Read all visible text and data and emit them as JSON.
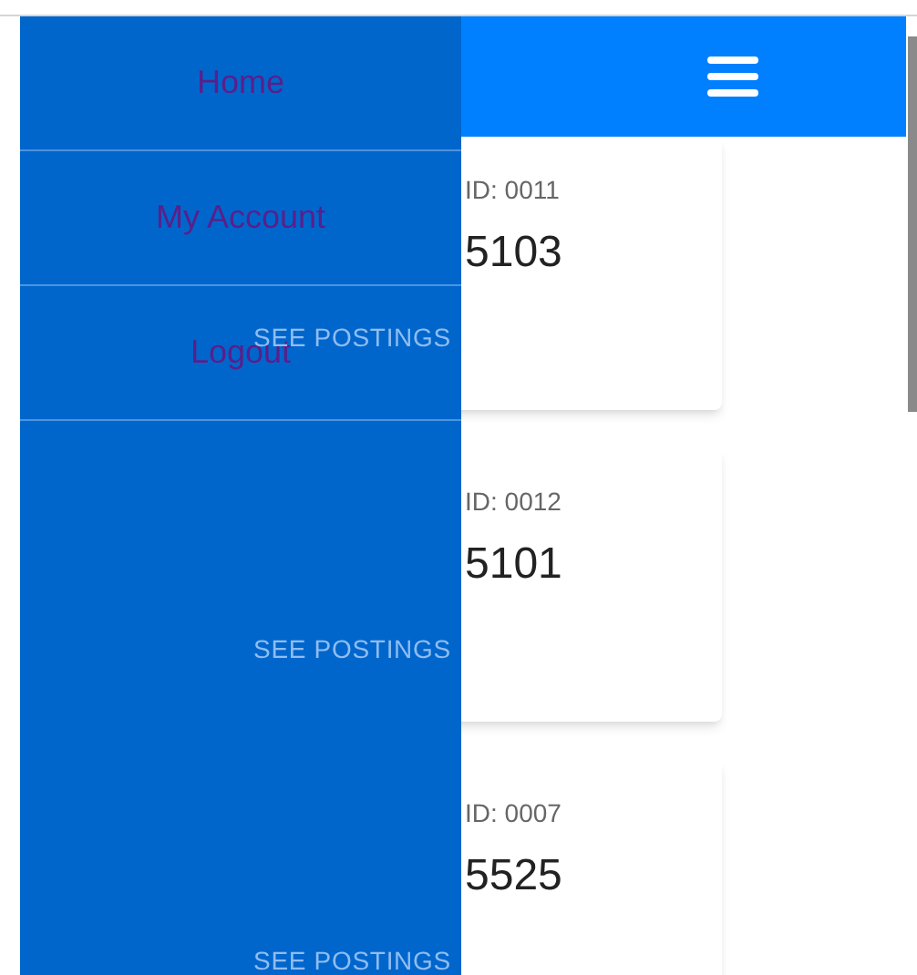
{
  "drawer": {
    "items": [
      {
        "label": "Home"
      },
      {
        "label": "My Account"
      },
      {
        "label": "Logout"
      }
    ]
  },
  "cards": [
    {
      "id_text": "ID: 0011",
      "number": "5103",
      "action": "SEE POSTINGS"
    },
    {
      "id_text": "ID: 0012",
      "number": "5101",
      "action": "SEE POSTINGS"
    },
    {
      "id_text": "ID: 0007",
      "number": "5525",
      "action": "SEE POSTINGS"
    }
  ]
}
